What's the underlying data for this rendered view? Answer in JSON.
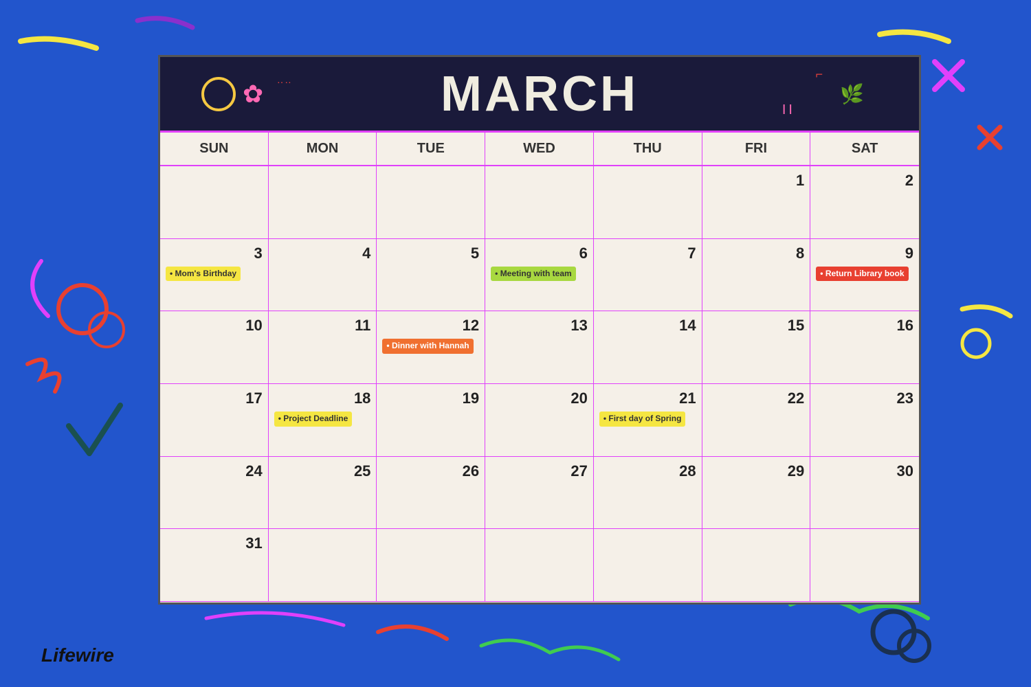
{
  "calendar": {
    "title": "MARCH",
    "days_of_week": [
      "SUN",
      "MON",
      "TUE",
      "WED",
      "THU",
      "FRI",
      "SAT"
    ],
    "weeks": [
      [
        {
          "day": "",
          "events": []
        },
        {
          "day": "",
          "events": []
        },
        {
          "day": "",
          "events": []
        },
        {
          "day": "",
          "events": []
        },
        {
          "day": "",
          "events": []
        },
        {
          "day": "1",
          "events": []
        },
        {
          "day": "2",
          "events": []
        }
      ],
      [
        {
          "day": "3",
          "events": [
            {
              "label": "Mom's Birthday",
              "color": "yellow"
            }
          ]
        },
        {
          "day": "4",
          "events": []
        },
        {
          "day": "5",
          "events": []
        },
        {
          "day": "6",
          "events": [
            {
              "label": "Meeting with team",
              "color": "green"
            }
          ]
        },
        {
          "day": "7",
          "events": []
        },
        {
          "day": "8",
          "events": []
        },
        {
          "day": "9",
          "events": [
            {
              "label": "Return Library book",
              "color": "red"
            }
          ]
        }
      ],
      [
        {
          "day": "10",
          "events": []
        },
        {
          "day": "11",
          "events": []
        },
        {
          "day": "12",
          "events": [
            {
              "label": "Dinner with Hannah",
              "color": "orange"
            }
          ]
        },
        {
          "day": "13",
          "events": []
        },
        {
          "day": "14",
          "events": []
        },
        {
          "day": "15",
          "events": []
        },
        {
          "day": "16",
          "events": []
        }
      ],
      [
        {
          "day": "17",
          "events": []
        },
        {
          "day": "18",
          "events": [
            {
              "label": "Project Deadline",
              "color": "yellow"
            }
          ]
        },
        {
          "day": "19",
          "events": []
        },
        {
          "day": "20",
          "events": []
        },
        {
          "day": "21",
          "events": [
            {
              "label": "First day of Spring",
              "color": "yellow"
            }
          ]
        },
        {
          "day": "22",
          "events": []
        },
        {
          "day": "23",
          "events": []
        }
      ],
      [
        {
          "day": "24",
          "events": []
        },
        {
          "day": "25",
          "events": []
        },
        {
          "day": "26",
          "events": []
        },
        {
          "day": "27",
          "events": []
        },
        {
          "day": "28",
          "events": []
        },
        {
          "day": "29",
          "events": []
        },
        {
          "day": "30",
          "events": []
        }
      ],
      [
        {
          "day": "31",
          "events": []
        },
        {
          "day": "",
          "events": []
        },
        {
          "day": "",
          "events": []
        },
        {
          "day": "",
          "events": []
        },
        {
          "day": "",
          "events": []
        },
        {
          "day": "",
          "events": []
        },
        {
          "day": "",
          "events": []
        }
      ]
    ],
    "logo": "Lifewire"
  }
}
